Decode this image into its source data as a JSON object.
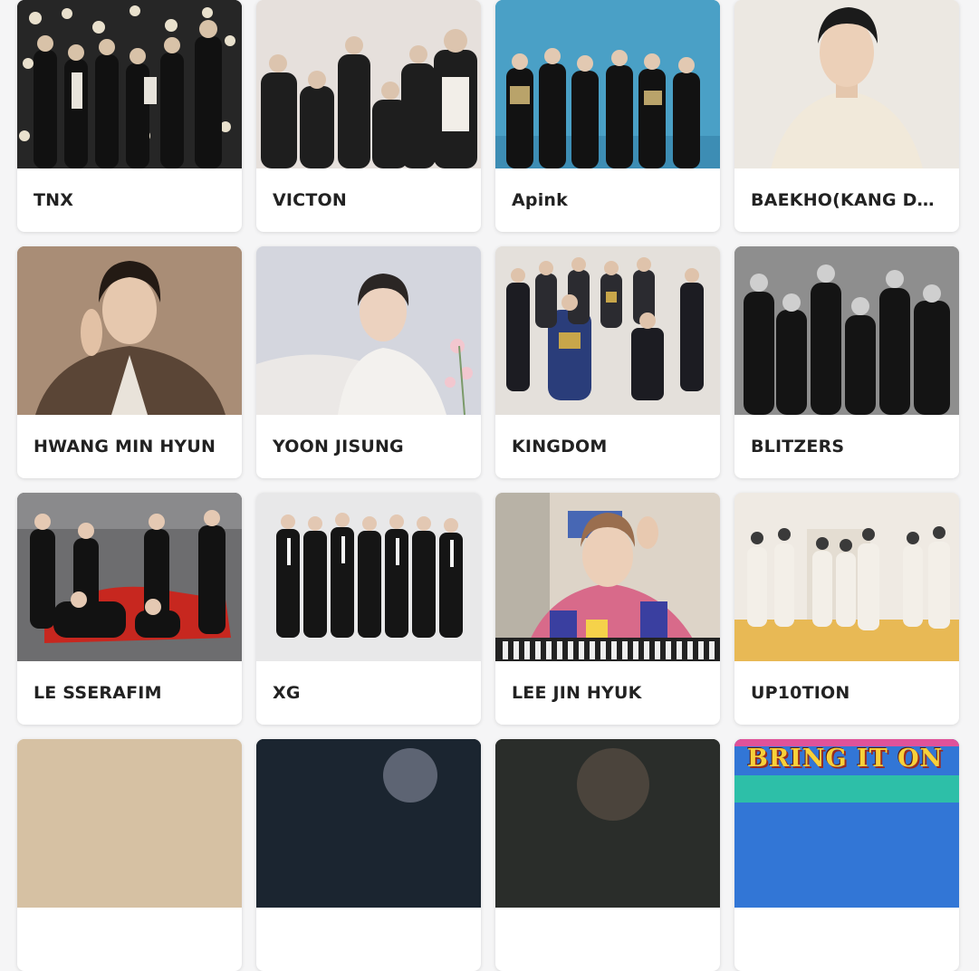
{
  "artists": [
    {
      "name": "TNX",
      "theme": "dark-studio-lights"
    },
    {
      "name": "VICTON",
      "theme": "light-gray"
    },
    {
      "name": "Apink",
      "theme": "blue"
    },
    {
      "name": "BAEKHO(KANG DONG HO)",
      "theme": "cream"
    },
    {
      "name": "HWANG MIN HYUN",
      "theme": "brown"
    },
    {
      "name": "YOON JISUNG",
      "theme": "pale-lavender"
    },
    {
      "name": "KINGDOM",
      "theme": "beige"
    },
    {
      "name": "BLITZERS",
      "theme": "grayscale"
    },
    {
      "name": "LE SSERAFIM",
      "theme": "race-track"
    },
    {
      "name": "XG",
      "theme": "white-studio"
    },
    {
      "name": "LEE JIN HYUK",
      "theme": "colorful"
    },
    {
      "name": "UP10TION",
      "theme": "warm-room"
    },
    {
      "name": "",
      "theme": "tan"
    },
    {
      "name": "",
      "theme": "dark-navy"
    },
    {
      "name": "",
      "theme": "dark-green"
    },
    {
      "name": "",
      "theme": "blue-banner",
      "banner_text": "BRING IT ON"
    }
  ],
  "colors": {
    "page_background": "#f5f5f6",
    "card_background": "#ffffff",
    "name_text": "#222222"
  }
}
